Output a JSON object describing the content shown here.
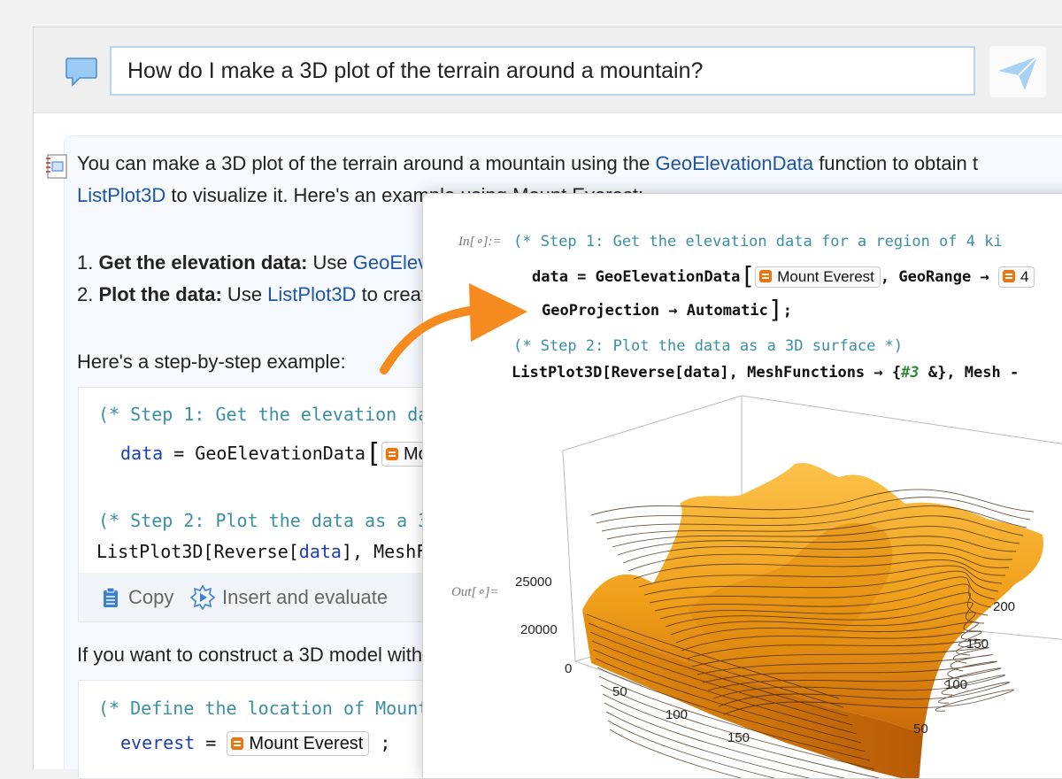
{
  "prompt": {
    "text": "How do I make a 3D plot of the terrain around a mountain?"
  },
  "answer": {
    "intro_a": "You can make a 3D plot of the terrain around a mountain using the ",
    "intro_link1": "GeoElevationData",
    "intro_b": " function to obtain t",
    "intro_link2": "ListPlot3D",
    "intro_c": " to visualize it. Here's an example using Mount Everest:",
    "step1_num": "1. ",
    "step1_bold": "Get the elevation data:",
    "step1_text": " Use ",
    "step1_link": "GeoEleva",
    "step2_num": "2. ",
    "step2_bold": "Plot the data:",
    "step2_text": " Use ",
    "step2_link": "ListPlot3D",
    "step2_tail": " to creat",
    "step_intro": "Here's a step-by-step example:",
    "model_line": "If you want to construct a 3D model with"
  },
  "code1": {
    "c1": "(* Step 1: Get the elevation da",
    "v1": "data",
    "eq": " = ",
    "f1": "GeoElevationData",
    "e1": "Mou",
    "c2": "(* Step 2: Plot the data as a 3",
    "f2": "ListPlot3D[Reverse[",
    "v2": "data",
    "f2b": "], MeshF"
  },
  "actions": {
    "copy": "Copy",
    "insert": "Insert and evaluate"
  },
  "code2": {
    "c1": "(* Define the location of Mount",
    "v1": "everest",
    "eq": " = ",
    "entity": "Mount Everest",
    "semi": " ;"
  },
  "notebook": {
    "in_label": "In[∘]:=",
    "out_label": "Out[∘]=",
    "c1": "(* Step 1: Get the elevation data for a region of 4 ki",
    "l2a": "data = GeoElevationData",
    "entity": "Mount Everest",
    "l2b": ", GeoRange → ",
    "l2c": "4",
    "l3": "GeoProjection → Automatic",
    "l3b": ";",
    "c2": "(* Step 2: Plot the data as a 3D surface *)",
    "l5a": "ListPlot3D[Reverse[data], MeshFunctions → {",
    "l5b": "#3",
    "l5c": " &}, Mesh -"
  },
  "plot_axes": {
    "z_ticks": [
      "25000",
      "20000",
      "0"
    ],
    "x_ticks": [
      "50",
      "100",
      "150"
    ],
    "y_ticks": [
      "200",
      "150",
      "100",
      "50"
    ]
  },
  "colors": {
    "accent": "#f58a1f",
    "link": "#1c55a4",
    "surface": "#f0a21a"
  }
}
